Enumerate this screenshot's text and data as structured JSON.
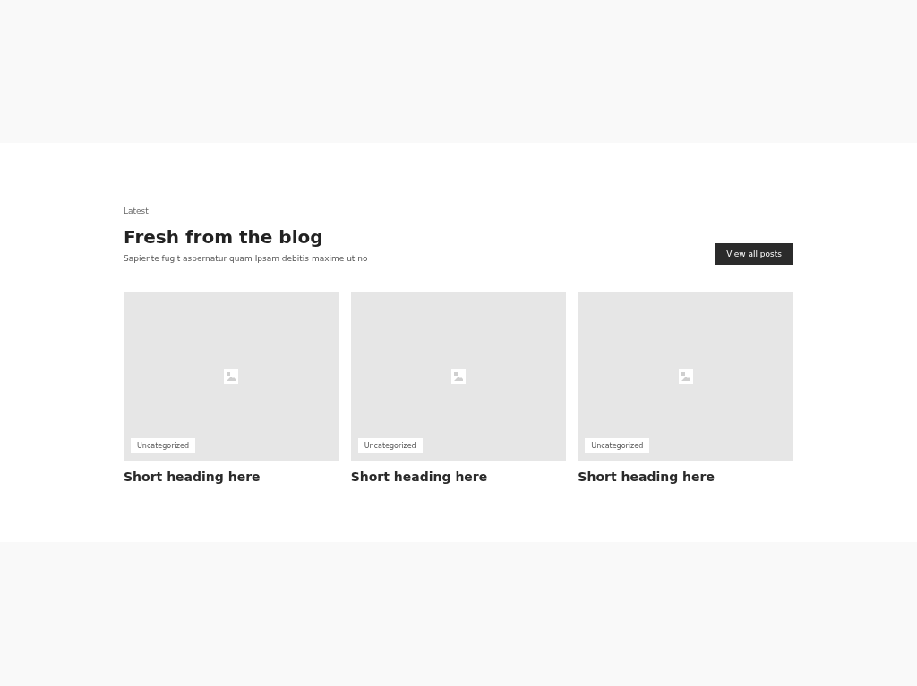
{
  "section": {
    "eyebrow": "Latest",
    "title": "Fresh from the blog",
    "subtitle": "Sapiente fugit aspernatur quam Ipsam debitis maxime ut no",
    "button": "View all posts"
  },
  "posts": [
    {
      "category": "Uncategorized",
      "title": "Short heading here"
    },
    {
      "category": "Uncategorized",
      "title": "Short heading here"
    },
    {
      "category": "Uncategorized",
      "title": "Short heading here"
    }
  ]
}
